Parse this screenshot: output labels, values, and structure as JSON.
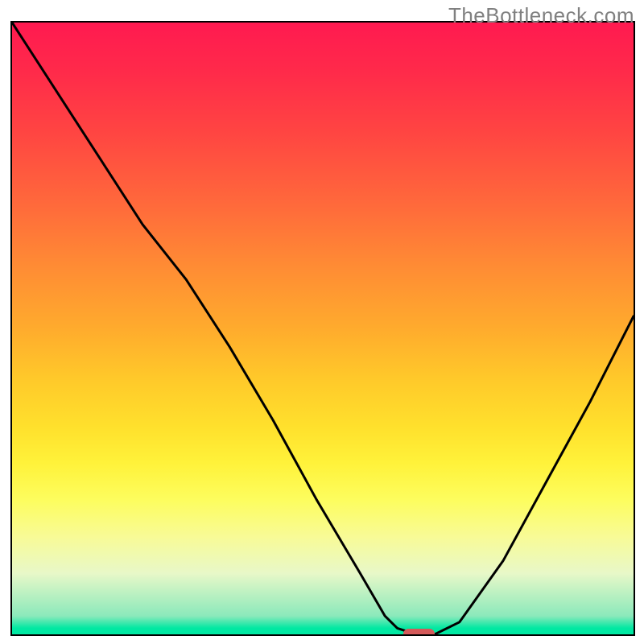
{
  "watermark": "TheBottleneck.com",
  "chart_data": {
    "type": "line",
    "title": "",
    "xlabel": "",
    "ylabel": "",
    "xlim": [
      0,
      100
    ],
    "ylim": [
      0,
      100
    ],
    "background": "heatmap-gradient-red-yellow-green",
    "series": [
      {
        "name": "bottleneck-curve",
        "x": [
          0,
          7,
          14,
          21,
          28,
          35,
          42,
          49,
          56,
          60,
          62,
          65,
          68,
          72,
          79,
          86,
          93,
          100
        ],
        "values": [
          100,
          89,
          78,
          67,
          58,
          47,
          35,
          22,
          10,
          3,
          1,
          0,
          0,
          2,
          12,
          25,
          38,
          52
        ]
      }
    ],
    "floor_marker": {
      "x_start": 63,
      "x_end": 68,
      "y": 0
    },
    "annotations": []
  },
  "colors": {
    "curve": "#000000",
    "marker": "#d45a5a",
    "axis": "#000000"
  }
}
